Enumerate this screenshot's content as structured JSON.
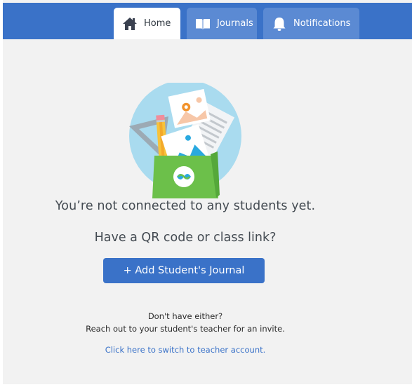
{
  "nav": {
    "tabs": [
      {
        "label": "Home",
        "icon": "house-icon",
        "active": true
      },
      {
        "label": "Journals",
        "icon": "book-icon",
        "active": false
      },
      {
        "label": "Notifications",
        "icon": "bell-icon",
        "active": false
      }
    ]
  },
  "main": {
    "headline": "You’re not connected to any students yet.",
    "subhead": "Have a QR code or class link?",
    "add_button_label": "+ Add Student's Journal",
    "help_line_1": "Don't have either?",
    "help_line_2": "Reach out to your student's teacher for an invite.",
    "switch_link_label": "Click here to switch to teacher account."
  },
  "colors": {
    "brand_blue": "#3a72c8",
    "tab_inactive": "#5b8ad3",
    "background": "#f2f2f2",
    "illustration_circle": "#a9dbef",
    "folder_green": "#6cc04a"
  }
}
